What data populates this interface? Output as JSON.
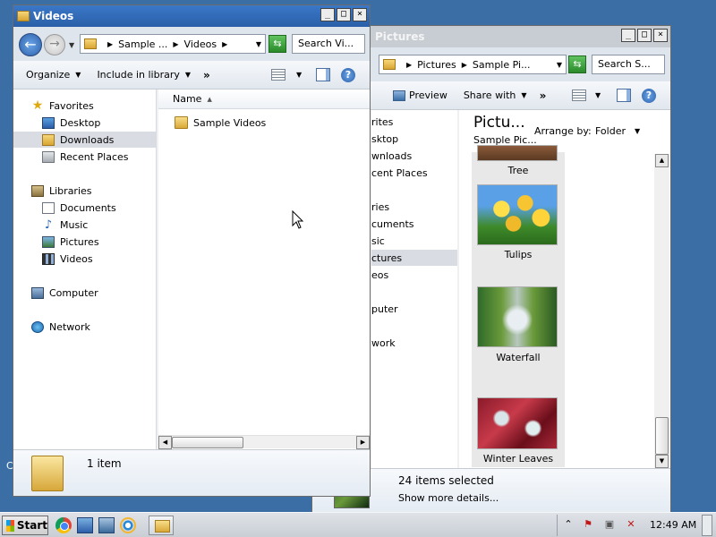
{
  "back_window": {
    "title": "Pictures",
    "address": {
      "seg1": "Pictures",
      "seg2": "Sample Pi..."
    },
    "search_placeholder": "Search S...",
    "toolbar": {
      "preview": "Preview",
      "share_with": "Share with",
      "more": "»"
    },
    "sidebar_partial": [
      "rites",
      "sktop",
      "wnloads",
      "cent Places",
      "ries",
      "cuments",
      "sic",
      "ctures",
      "eos",
      "puter",
      "work"
    ],
    "library_title": "Pictu...",
    "library_subtitle": "Sample Pic...",
    "arrange_label": "Arrange by:",
    "arrange_value": "Folder",
    "thumbnails": [
      "Tree",
      "Tulips",
      "Waterfall",
      "Winter Leaves"
    ],
    "status": {
      "selected": "24 items selected",
      "more_details": "Show more details..."
    }
  },
  "front_window": {
    "title": "Videos",
    "address": {
      "seg1": "Sample ...",
      "seg2": "Videos"
    },
    "search_placeholder": "Search Vi...",
    "toolbar": {
      "organize": "Organize",
      "include_in_library": "Include in library",
      "more": "»"
    },
    "sidebar": {
      "favorites": "Favorites",
      "desktop": "Desktop",
      "downloads": "Downloads",
      "recent_places": "Recent Places",
      "libraries": "Libraries",
      "documents": "Documents",
      "music": "Music",
      "pictures": "Pictures",
      "videos": "Videos",
      "computer": "Computer",
      "network": "Network"
    },
    "column_name": "Name",
    "files": [
      "Sample Videos"
    ],
    "status_count": "1 item"
  },
  "desktop_partial_label": "C",
  "taskbar": {
    "start": "Start",
    "clock": "12:49 AM"
  },
  "colors": {
    "desktop": "#3a6ea5",
    "titlebar_active": "#2a5fa8",
    "selection": "#d9dde3"
  }
}
